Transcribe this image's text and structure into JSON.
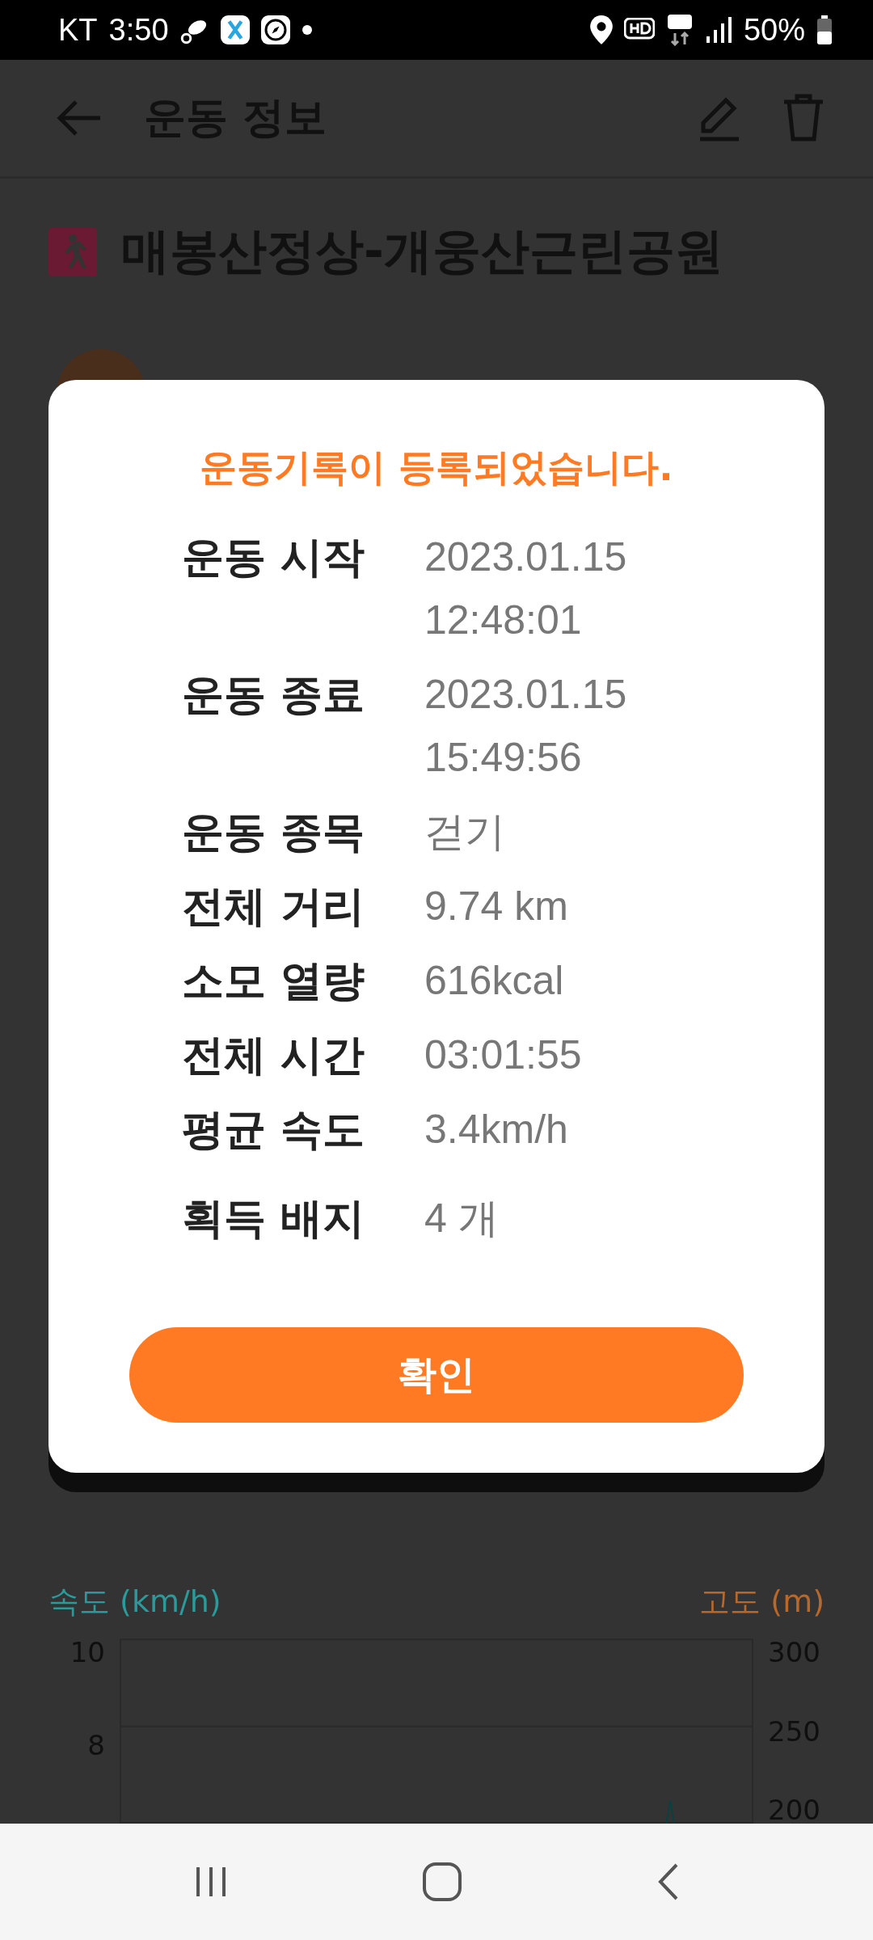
{
  "status_bar": {
    "carrier": "KT",
    "time": "3:50",
    "battery": "50%"
  },
  "app_bar": {
    "title": "운동 정보"
  },
  "activity": {
    "title": "매봉산정상-개웅산근린공원"
  },
  "chart": {
    "left_label": "속도 (km/h)",
    "right_label": "고도 (m)",
    "left_ticks": [
      "10",
      "8"
    ],
    "right_ticks": [
      "300",
      "250",
      "200"
    ]
  },
  "dialog": {
    "title": "운동기록이 등록되었습니다.",
    "rows": [
      {
        "label": "운동 시작",
        "value": "2023.01.15\n12:48:01"
      },
      {
        "label": "운동 종료",
        "value": "2023.01.15\n15:49:56"
      },
      {
        "label": "운동 종목",
        "value": "걷기"
      },
      {
        "label": "전체 거리",
        "value": "9.74 km"
      },
      {
        "label": "소모 열량",
        "value": "616kcal"
      },
      {
        "label": "전체 시간",
        "value": "03:01:55"
      },
      {
        "label": "평균 속도",
        "value": "3.4km/h"
      },
      {
        "label": "획득 배지",
        "value": "4 개"
      }
    ],
    "button": "확인"
  }
}
